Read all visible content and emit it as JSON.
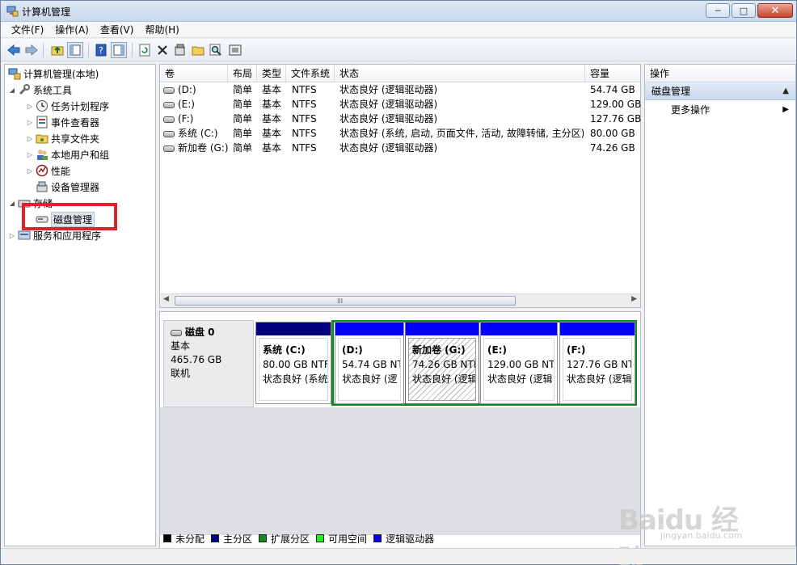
{
  "window": {
    "title": "计算机管理"
  },
  "menu": [
    "文件(F)",
    "操作(A)",
    "查看(V)",
    "帮助(H)"
  ],
  "tree": {
    "root": "计算机管理(本地)",
    "system_tools": "系统工具",
    "task_scheduler": "任务计划程序",
    "event_viewer": "事件查看器",
    "shared_folders": "共享文件夹",
    "local_users": "本地用户和组",
    "performance": "性能",
    "device_manager": "设备管理器",
    "storage": "存储",
    "disk_management": "磁盘管理",
    "services_apps": "服务和应用程序"
  },
  "columns": {
    "volume": "卷",
    "layout": "布局",
    "type": "类型",
    "fs": "文件系统",
    "status": "状态",
    "capacity": "容量"
  },
  "volumes": [
    {
      "volume": "(D:)",
      "layout": "简单",
      "type": "基本",
      "fs": "NTFS",
      "status": "状态良好 (逻辑驱动器)",
      "capacity": "54.74 GB"
    },
    {
      "volume": "(E:)",
      "layout": "简单",
      "type": "基本",
      "fs": "NTFS",
      "status": "状态良好 (逻辑驱动器)",
      "capacity": "129.00 GB"
    },
    {
      "volume": "(F:)",
      "layout": "简单",
      "type": "基本",
      "fs": "NTFS",
      "status": "状态良好 (逻辑驱动器)",
      "capacity": "127.76 GB"
    },
    {
      "volume": "系统 (C:)",
      "layout": "简单",
      "type": "基本",
      "fs": "NTFS",
      "status": "状态良好 (系统, 启动, 页面文件, 活动, 故障转储, 主分区)",
      "capacity": "80.00 GB"
    },
    {
      "volume": "新加卷 (G:)",
      "layout": "简单",
      "type": "基本",
      "fs": "NTFS",
      "status": "状态良好 (逻辑驱动器)",
      "capacity": "74.26 GB"
    }
  ],
  "scroll_grip": "III",
  "disk": {
    "name": "磁盘 0",
    "kind": "基本",
    "size": "465.76 GB",
    "state": "联机"
  },
  "partitions": [
    {
      "name": "系统 (C:)",
      "size": "80.00 GB NTF",
      "status": "状态良好 (系统"
    },
    {
      "name": "(D:)",
      "size": "54.74 GB NT",
      "status": "状态良好 (逻"
    },
    {
      "name": "新加卷 (G:)",
      "size": "74.26 GB NTF",
      "status": "状态良好 (逻辑"
    },
    {
      "name": "(E:)",
      "size": "129.00 GB NTI",
      "status": "状态良好 (逻辑"
    },
    {
      "name": "(F:)",
      "size": "127.76 GB NT",
      "status": "状态良好 (逻辑"
    }
  ],
  "legend": [
    {
      "label": "未分配",
      "color": "#000000"
    },
    {
      "label": "主分区",
      "color": "#000080"
    },
    {
      "label": "扩展分区",
      "color": "#158b1e"
    },
    {
      "label": "可用空间",
      "color": "#22ee22"
    },
    {
      "label": "逻辑驱动器",
      "color": "#0000ff"
    }
  ],
  "actions": {
    "header": "操作",
    "section": "磁盘管理",
    "more": "更多操作"
  },
  "watermark": {
    "main": "Baidu 经验",
    "sub": "jingyan.baidu.com"
  },
  "colors": {
    "primary_bar": "#000080",
    "logical_bar": "#0000ff",
    "extended_border": "#158b1e",
    "highlight": "#e0202a"
  }
}
